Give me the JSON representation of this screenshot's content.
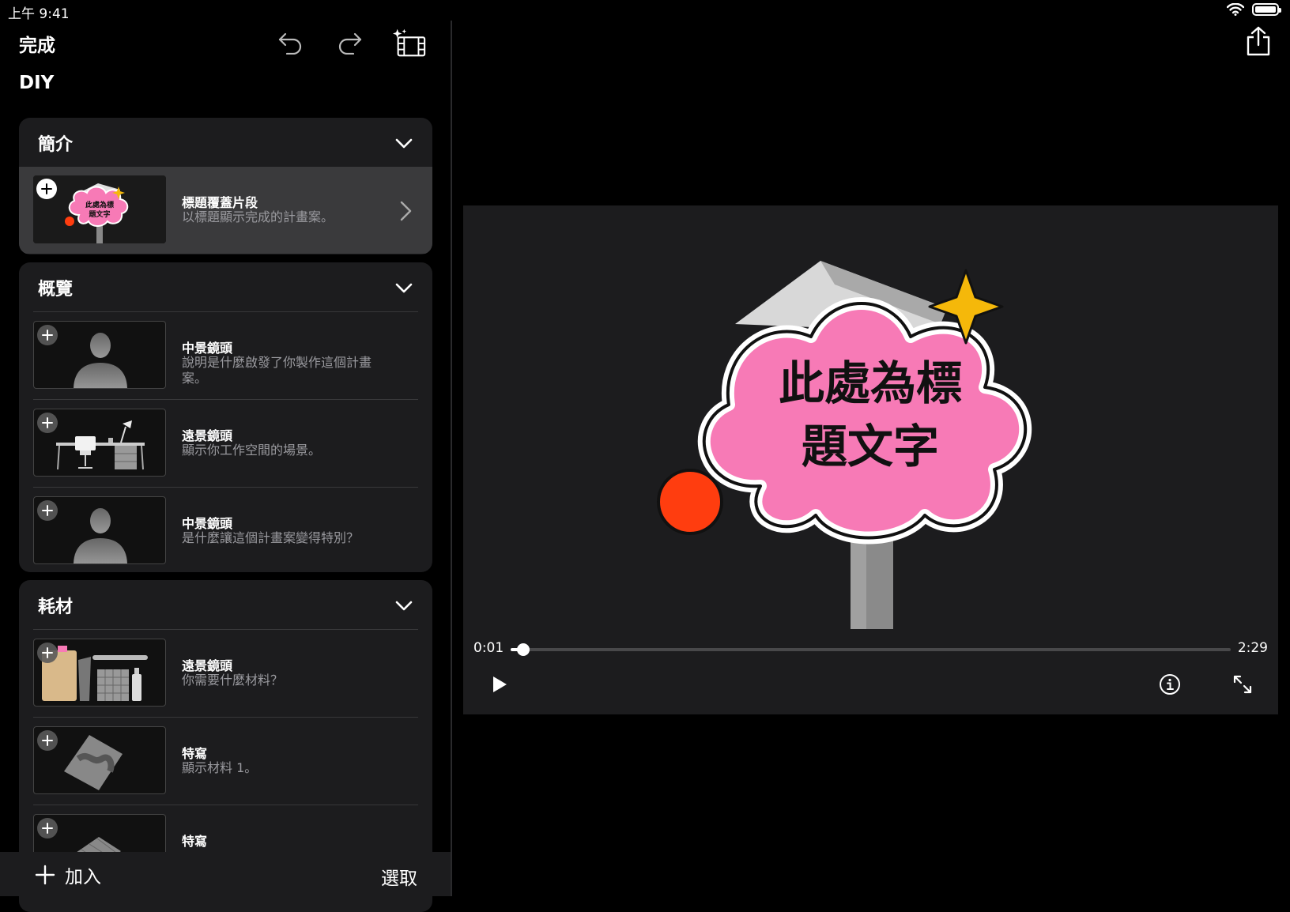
{
  "status": {
    "time": "上午 9:41"
  },
  "toolbar": {
    "done_label": "完成"
  },
  "project": {
    "title": "DIY"
  },
  "sections": [
    {
      "title": "簡介",
      "rows": [
        {
          "title": "標題覆蓋片段",
          "desc": "以標題顯示完成的計畫案。"
        }
      ]
    },
    {
      "title": "概覽",
      "rows": [
        {
          "title": "中景鏡頭",
          "desc": "說明是什麼啟發了你製作這個計畫案。"
        },
        {
          "title": "遠景鏡頭",
          "desc": "顯示你工作空間的場景。"
        },
        {
          "title": "中景鏡頭",
          "desc": "是什麼讓這個計畫案變得特別？"
        }
      ]
    },
    {
      "title": "耗材",
      "rows": [
        {
          "title": "遠景鏡頭",
          "desc": "你需要什麼材料？"
        },
        {
          "title": "特寫",
          "desc": "顯示材料 1。"
        },
        {
          "title": "特寫",
          "desc": ""
        }
      ]
    }
  ],
  "thumbnail": {
    "title_text": "此處為標題文字"
  },
  "bottom": {
    "add_label": "加入",
    "select_label": "選取"
  },
  "preview": {
    "title_line1": "此處為標",
    "title_line2": "題文字",
    "time_current": "0:01",
    "time_total": "2:29",
    "progress": 0.0067
  },
  "colors": {
    "bubble_pink": "#f77ab6",
    "sparkle": "#f5b80a",
    "dot_red": "#ff3d0f",
    "panel": "#1c1c1e"
  },
  "icons": [
    "undo-icon",
    "redo-icon",
    "magic-movie-icon",
    "share-icon",
    "chevron-down-icon",
    "chevron-right-icon",
    "plus-icon",
    "play-icon",
    "info-icon",
    "fullscreen-icon",
    "wifi-icon",
    "battery-icon"
  ]
}
